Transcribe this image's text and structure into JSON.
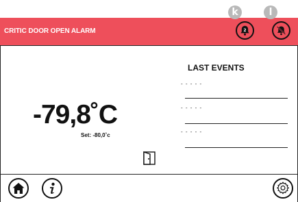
{
  "callouts": {
    "left": "k",
    "right": "l"
  },
  "header": {
    "title": "CRITIC DOOR OPEN ALARM",
    "bell_badge": "2",
    "color": "#ee4f5b"
  },
  "reading": {
    "temperature": "-79,8˚C",
    "setpoint": "Set: -80,0˚c"
  },
  "events": {
    "title": "LAST EVENTS",
    "items": [
      "- - - - -",
      "- - - - -",
      "- - - - -"
    ]
  },
  "footer": {
    "icons": [
      "home-icon",
      "info-icon",
      "settings-icon"
    ]
  }
}
